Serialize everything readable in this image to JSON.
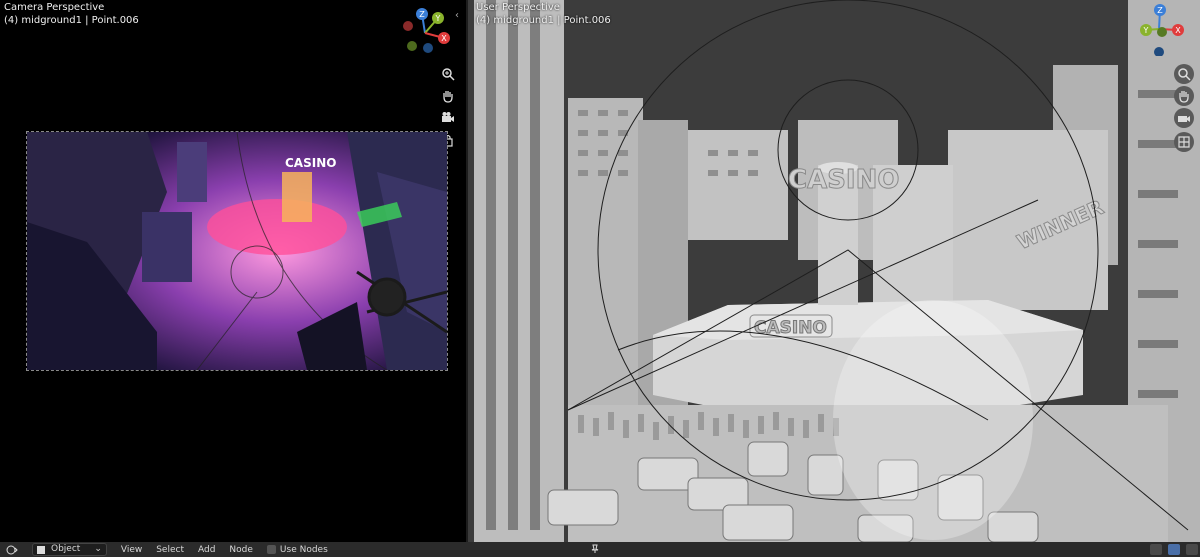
{
  "left_viewport": {
    "title": "Camera Perspective",
    "subtitle": "(4) midground1 | Point.006",
    "gizmo": {
      "z": "Z",
      "y": "Y",
      "x": "X"
    },
    "nav_icons": [
      "zoom-icon",
      "hand-pan-icon",
      "camera-view-icon",
      "lock-icon"
    ]
  },
  "right_viewport": {
    "title": "User Perspective",
    "subtitle": "(4) midground1 | Point.006",
    "gizmo": {
      "z": "Z",
      "y": "Y",
      "x": "X"
    },
    "nav_icons": [
      "zoom-icon",
      "hand-pan-icon",
      "camera-view-icon",
      "grid-view-icon"
    ],
    "scene_text": {
      "sign_top": "CASINO",
      "sign_winner": "WINNER",
      "sign_front": "CASINO"
    }
  },
  "render_preview": {
    "sign": "CASINO"
  },
  "bottom_bar": {
    "mode": "Object",
    "menus": [
      "View",
      "Select",
      "Add",
      "Node"
    ],
    "use_nodes_label": "Use Nodes"
  },
  "colors": {
    "viewport_bg": "#3c3c3c",
    "axis_x": "#e03c3c",
    "axis_y": "#8ab32c",
    "axis_z": "#3b7fd8"
  }
}
